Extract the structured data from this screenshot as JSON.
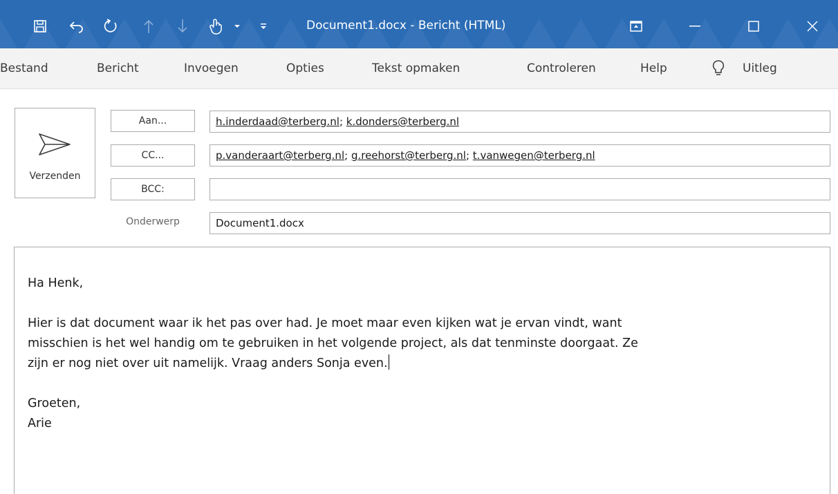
{
  "window": {
    "title": "Document1.docx  -  Bericht (HTML)",
    "quick_access_icons": [
      "save-icon",
      "undo-icon",
      "redo-icon",
      "up-arrow-icon",
      "down-arrow-icon",
      "touch-mode-icon",
      "dropdown-arrow-icon",
      "customize-icon"
    ],
    "controls": [
      "ribbon-display-icon",
      "minimize-icon",
      "maximize-icon",
      "close-icon"
    ]
  },
  "ribbon": {
    "tabs": [
      {
        "label": "Bestand"
      },
      {
        "label": "Bericht"
      },
      {
        "label": "Invoegen"
      },
      {
        "label": "Opties"
      },
      {
        "label": "Tekst opmaken"
      },
      {
        "label": "Controleren"
      },
      {
        "label": "Help"
      },
      {
        "label": "Uitleg"
      }
    ]
  },
  "compose": {
    "send_label": "Verzenden",
    "to_button": "Aan...",
    "cc_button": "CC...",
    "bcc_button": "BCC:",
    "subject_label": "Onderwerp",
    "to": [
      "h.inderdaad@terberg.nl",
      "k.donders@terberg.nl"
    ],
    "cc": [
      "p.vanderaart@terberg.nl",
      "g.reehorst@terberg.nl",
      "t.vanwegen@terberg.nl"
    ],
    "bcc": "",
    "subject": "Document1.docx",
    "separator": "; "
  },
  "message": {
    "greeting": "Ha Henk,",
    "line1": "Hier is dat document waar ik het pas over had. Je moet maar even kijken wat je ervan vindt, want",
    "line2": "misschien is het wel handig om te gebruiken in het volgende project, als dat tenminste doorgaat. Ze",
    "line3": "zijn er nog niet over uit namelijk. Vraag anders Sonja even.",
    "closing": "Groeten,",
    "signature": "Arie"
  },
  "colors": {
    "titlebar": "#2b6cb5",
    "ribbon": "#f3f3f3",
    "border": "#ababab"
  }
}
